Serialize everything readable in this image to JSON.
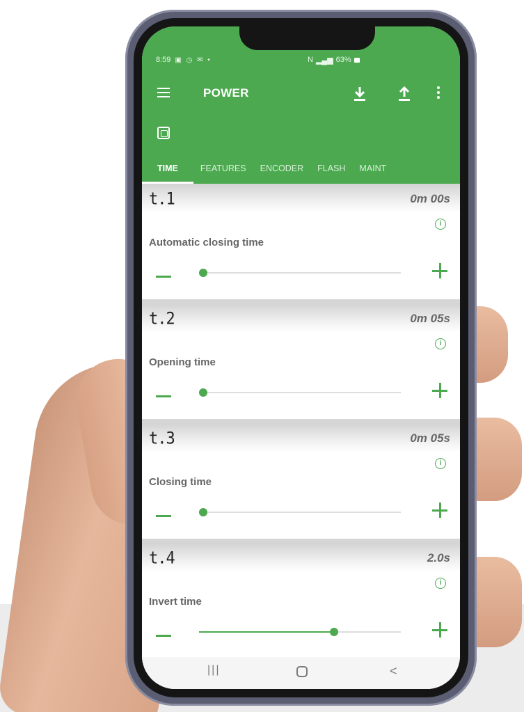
{
  "status_bar": {
    "time": "8:59",
    "battery": "63%"
  },
  "app_bar": {
    "title": "POWER"
  },
  "tabs": [
    {
      "label": "TIME",
      "active": true
    },
    {
      "label": "FEATURES",
      "active": false
    },
    {
      "label": "ENCODER",
      "active": false
    },
    {
      "label": "FLASH",
      "active": false
    },
    {
      "label": "MAINT",
      "active": false
    }
  ],
  "params": [
    {
      "code": "t.1",
      "value": "0m 00s",
      "label": "Automatic closing time",
      "slider_fraction": 0.02
    },
    {
      "code": "t.2",
      "value": "0m 05s",
      "label": "Opening time",
      "slider_fraction": 0.02
    },
    {
      "code": "t.3",
      "value": "0m 05s",
      "label": "Closing time",
      "slider_fraction": 0.02
    },
    {
      "code": "t.4",
      "value": "2.0s",
      "label": "Invert time",
      "slider_fraction": 0.67
    }
  ],
  "colors": {
    "accent": "#4ca94f",
    "value_text": "#666666"
  },
  "icons": [
    "menu-icon",
    "download-icon",
    "upload-icon",
    "more-vert-icon",
    "device-icon",
    "info-icon",
    "minus-icon",
    "plus-icon",
    "nav-recent-icon",
    "nav-home-icon",
    "nav-back-icon"
  ]
}
